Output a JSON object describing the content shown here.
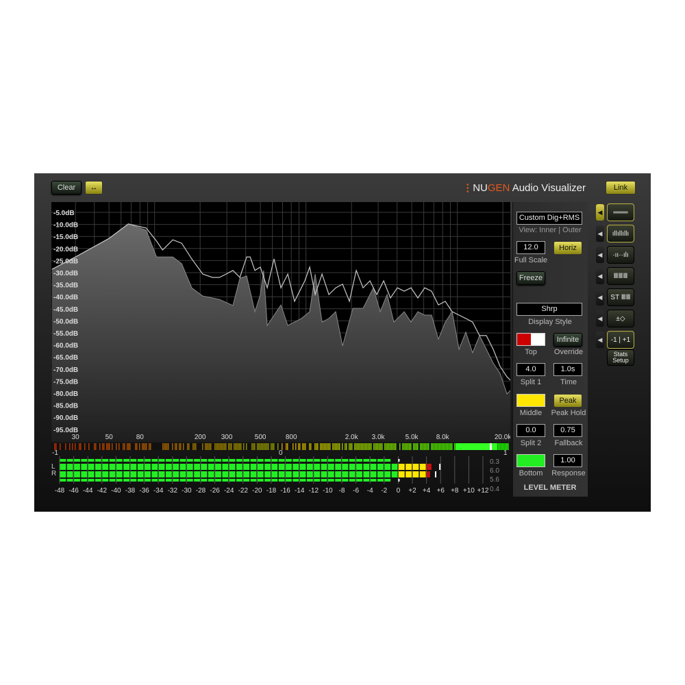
{
  "toolbar": {
    "clear": "Clear",
    "swap_icon": "↔",
    "link": "Link"
  },
  "brand": {
    "dots": "⋮",
    "nu": "NU",
    "gen": "GEN",
    "rest": " Audio Visualizer",
    "accent": "#e05a1e"
  },
  "side": {
    "preset": "Custom Dig+RMS",
    "view": "View: Inner | Outer",
    "full_scale_value": "12.0",
    "full_scale_label": "Full Scale",
    "horiz": "Horiz",
    "freeze": "Freeze",
    "display_style_value": "Shrp",
    "display_style_label": "Display Style",
    "top_label": "Top",
    "top_colors": [
      "#cc0000",
      "#ffffff"
    ],
    "infinite": "Infinite",
    "override_label": "Override",
    "split1_value": "4.0",
    "split1_label": "Split 1",
    "time_value": "1.0s",
    "time_label": "Time",
    "middle_label": "Middle",
    "middle_color": "#ffe600",
    "peak": "Peak",
    "peak_hold_label": "Peak Hold",
    "split2_value": "0.0",
    "split2_label": "Split 2",
    "fallback_value": "0.75",
    "fallback_label": "Fallback",
    "bottom_label": "Bottom",
    "bottom_color": "#22ee22",
    "response_value": "1.00",
    "response_label": "Response",
    "section_title": "LEVEL METER"
  },
  "mode_buttons": [
    {
      "icon": "levels-lines-icon",
      "glyph": "═══",
      "active": true
    },
    {
      "icon": "spectrum-bars-icon",
      "glyph": "ıllıllıllı",
      "active": true
    },
    {
      "icon": "difference-spectrum-icon",
      "glyph": "·ıı··ılı",
      "active": false
    },
    {
      "icon": "spectrogram-icon",
      "glyph": "ⅢⅢⅢ",
      "active": false
    },
    {
      "icon": "stereo-spectrogram-icon",
      "glyph": "ST ⅢⅢ",
      "active": false
    },
    {
      "icon": "plus-minus-diamond-icon",
      "glyph": "±◇",
      "active": false
    },
    {
      "icon": "correlation-icon",
      "glyph": "-1 | +1",
      "active": true
    }
  ],
  "stats_setup": "Stats Setup",
  "chart_data": {
    "type": "area",
    "x_scale": "log",
    "xlim": [
      20.8,
      22400
    ],
    "ylim": [
      -97,
      0
    ],
    "grid": true,
    "x_ticks": [
      {
        "v": 30,
        "label": "30"
      },
      {
        "v": 50,
        "label": "50"
      },
      {
        "v": 80,
        "label": "80"
      },
      {
        "v": 200,
        "label": "200"
      },
      {
        "v": 300,
        "label": "300"
      },
      {
        "v": 500,
        "label": "500"
      },
      {
        "v": 800,
        "label": "800"
      },
      {
        "v": 2000,
        "label": "2.0k"
      },
      {
        "v": 3000,
        "label": "3.0k"
      },
      {
        "v": 5000,
        "label": "5.0k"
      },
      {
        "v": 8000,
        "label": "8.0k"
      },
      {
        "v": 20000,
        "label": "20.0k"
      }
    ],
    "y_ticks": [
      "-5.0dB",
      "-10.0dB",
      "-15.0dB",
      "-20.0dB",
      "-25.0dB",
      "-30.0dB",
      "-35.0dB",
      "-40.0dB",
      "-45.0dB",
      "-50.0dB",
      "-55.0dB",
      "-60.0dB",
      "-65.0dB",
      "-70.0dB",
      "-75.0dB",
      "-80.0dB",
      "-85.0dB",
      "-90.0dB",
      "-95.0dB"
    ],
    "series": [
      {
        "style": "filled",
        "points": [
          [
            21,
            -28.6
          ],
          [
            30,
            -23.5
          ],
          [
            50,
            -15.8
          ],
          [
            67,
            -9.8
          ],
          [
            88,
            -12.4
          ],
          [
            103,
            -23.5
          ],
          [
            132,
            -23.5
          ],
          [
            151,
            -26.3
          ],
          [
            176,
            -36.3
          ],
          [
            208,
            -39.7
          ],
          [
            268,
            -41.1
          ],
          [
            329,
            -43.6
          ],
          [
            366,
            -32.3
          ],
          [
            380,
            -32
          ],
          [
            406,
            -31.4
          ],
          [
            460,
            -46.2
          ],
          [
            500,
            -39.1
          ],
          [
            525,
            -29.1
          ],
          [
            555,
            -51.9
          ],
          [
            683,
            -43.4
          ],
          [
            758,
            -51.9
          ],
          [
            933,
            -49
          ],
          [
            1059,
            -46.2
          ],
          [
            1151,
            -30.6
          ],
          [
            1277,
            -50.5
          ],
          [
            1417,
            -49
          ],
          [
            1572,
            -46.2
          ],
          [
            1745,
            -60.4
          ],
          [
            2040,
            -44.8
          ],
          [
            2383,
            -44.8
          ],
          [
            2787,
            -36.3
          ],
          [
            3093,
            -46.2
          ],
          [
            3435,
            -39.1
          ],
          [
            3810,
            -50.5
          ],
          [
            4458,
            -46.2
          ],
          [
            4945,
            -50.5
          ],
          [
            5485,
            -46.2
          ],
          [
            6090,
            -47.6
          ],
          [
            6761,
            -47.6
          ],
          [
            7500,
            -57.6
          ],
          [
            8320,
            -50.5
          ],
          [
            9249,
            -46.2
          ],
          [
            10260,
            -61.8
          ],
          [
            11380,
            -54.7
          ],
          [
            12620,
            -63.2
          ],
          [
            14030,
            -56.1
          ],
          [
            15560,
            -61.8
          ],
          [
            17260,
            -67.5
          ],
          [
            19150,
            -71.8
          ],
          [
            21290,
            -80.3
          ],
          [
            22400,
            -78.9
          ]
        ]
      },
      {
        "style": "line",
        "points": [
          [
            21,
            -28.6
          ],
          [
            30,
            -23.5
          ],
          [
            50,
            -15.8
          ],
          [
            67,
            -9.8
          ],
          [
            88,
            -11.5
          ],
          [
            103,
            -16.9
          ],
          [
            113,
            -20.6
          ],
          [
            132,
            -16.4
          ],
          [
            151,
            -17.8
          ],
          [
            176,
            -24.3
          ],
          [
            208,
            -30.6
          ],
          [
            241,
            -32
          ],
          [
            268,
            -32
          ],
          [
            297,
            -30.6
          ],
          [
            329,
            -29.1
          ],
          [
            366,
            -32
          ],
          [
            406,
            -23.5
          ],
          [
            428,
            -23.5
          ],
          [
            460,
            -29.1
          ],
          [
            500,
            -27.7
          ],
          [
            555,
            -36.3
          ],
          [
            615,
            -24.3
          ],
          [
            683,
            -36.3
          ],
          [
            758,
            -30.6
          ],
          [
            841,
            -41.9
          ],
          [
            983,
            -33.4
          ],
          [
            1059,
            -27.7
          ],
          [
            1151,
            -39.1
          ],
          [
            1277,
            -30.6
          ],
          [
            1417,
            -39.1
          ],
          [
            1572,
            -36.3
          ],
          [
            1745,
            -34.8
          ],
          [
            1937,
            -41.9
          ],
          [
            2149,
            -29.1
          ],
          [
            2383,
            -36.3
          ],
          [
            2648,
            -33.4
          ],
          [
            2937,
            -39.1
          ],
          [
            3261,
            -33.4
          ],
          [
            3615,
            -40.5
          ],
          [
            4016,
            -36.3
          ],
          [
            4458,
            -37.7
          ],
          [
            4945,
            -36.3
          ],
          [
            5485,
            -40.5
          ],
          [
            6090,
            -36.3
          ],
          [
            6761,
            -37.7
          ],
          [
            7500,
            -43.4
          ],
          [
            8320,
            -41.9
          ],
          [
            9249,
            -46.2
          ],
          [
            10260,
            -47.6
          ],
          [
            11380,
            -49
          ],
          [
            12620,
            -50.5
          ],
          [
            14030,
            -56.1
          ],
          [
            15560,
            -56.1
          ],
          [
            17260,
            -61.8
          ],
          [
            19150,
            -68.9
          ],
          [
            21290,
            -73.2
          ],
          [
            22400,
            -74.6
          ]
        ]
      }
    ]
  },
  "correlation": {
    "min_label": "-1",
    "mid_label": "0",
    "max_label": "1",
    "value": 0.97
  },
  "level_meter": {
    "channels": [
      "L",
      "R"
    ],
    "scale": [
      "-48",
      "-46",
      "-44",
      "-42",
      "-40",
      "-38",
      "-36",
      "-34",
      "-32",
      "-30",
      "-28",
      "-26",
      "-24",
      "-22",
      "-20",
      "-18",
      "-16",
      "-14",
      "-12",
      "-10",
      "-8",
      "-6",
      "-4",
      "-2",
      "0",
      "+2",
      "+4",
      "+6",
      "+8",
      "+10",
      "+12"
    ],
    "levels_db": {
      "L": 4.8,
      "R": 4.6
    },
    "peak_hold_db": {
      "L": 5.8,
      "R": 5.2
    },
    "rms_db": {
      "L": -1,
      "R": -1
    },
    "readouts": [
      "0.3",
      "6.0",
      "5.6",
      "0.4"
    ]
  }
}
